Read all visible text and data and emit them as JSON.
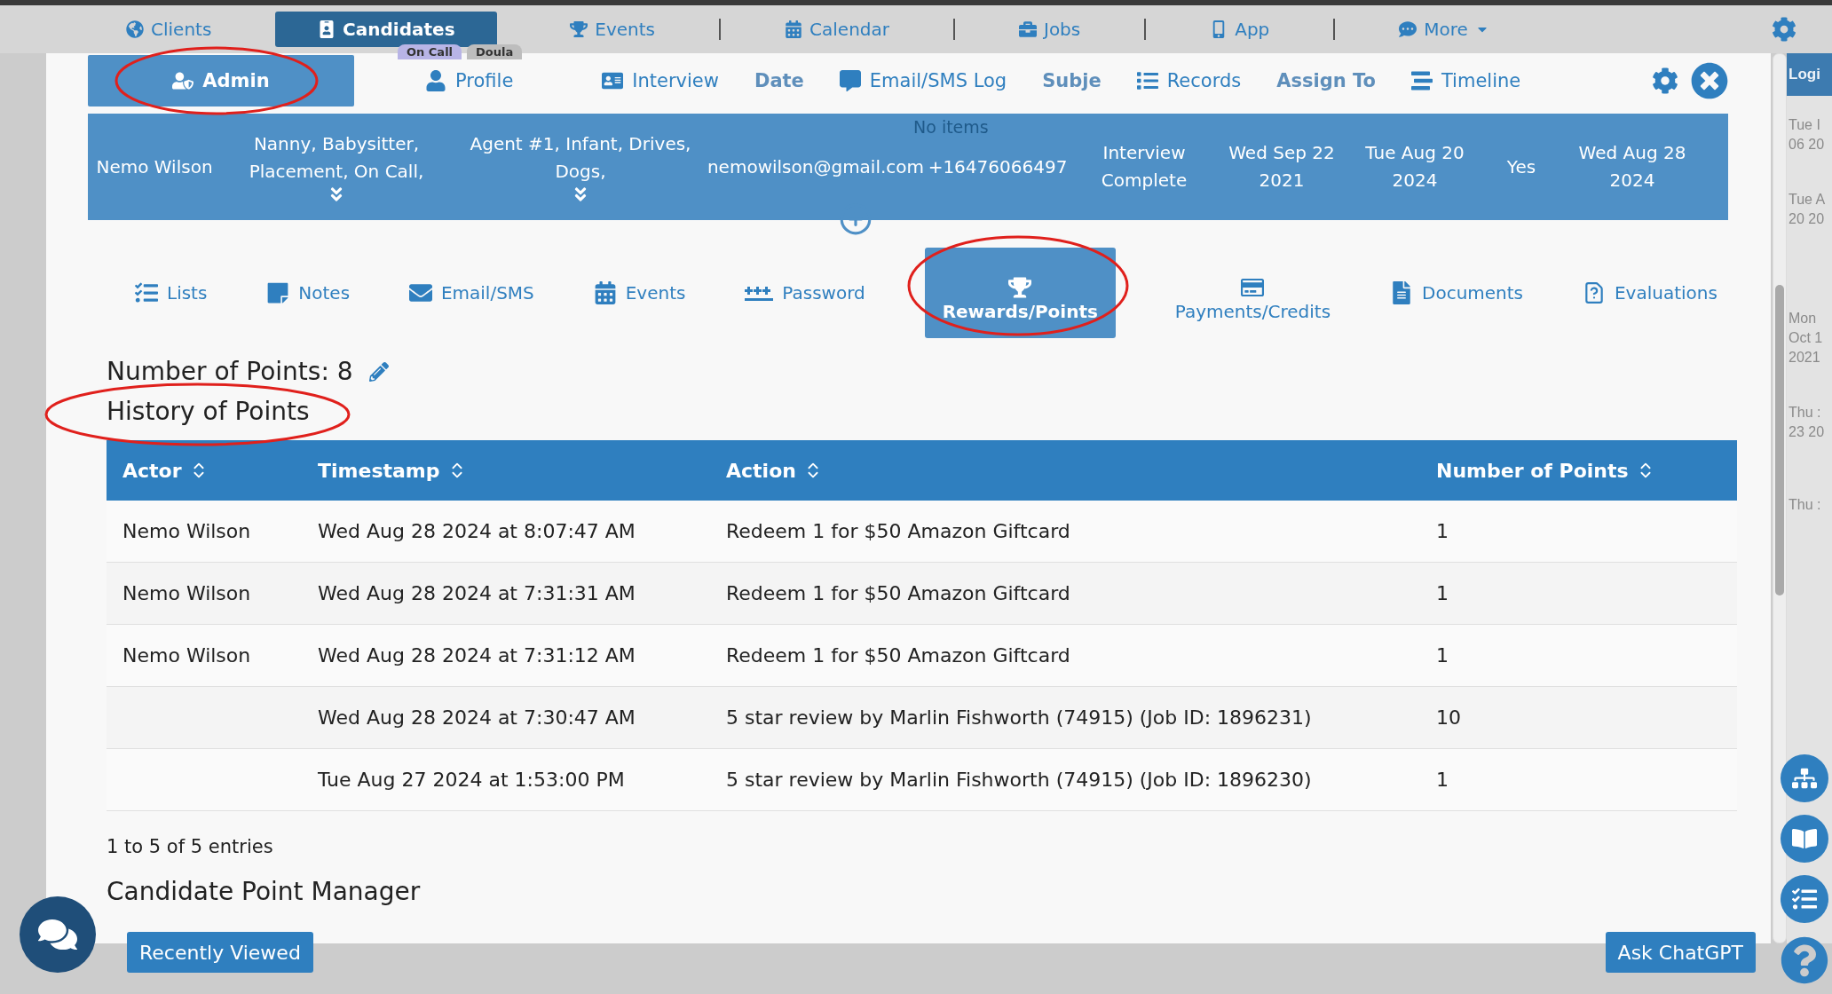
{
  "top_nav": {
    "items": [
      {
        "label": "Clients",
        "selected": false
      },
      {
        "label": "Candidates",
        "selected": true
      },
      {
        "label": "Events",
        "selected": false
      },
      {
        "label": "Calendar",
        "selected": false
      },
      {
        "label": "Jobs",
        "selected": false
      },
      {
        "label": "App",
        "selected": false
      },
      {
        "label": "More",
        "selected": false
      }
    ],
    "badges": [
      "On Call",
      "Doula"
    ]
  },
  "background_header": {
    "columns": [
      "Date",
      "Subje",
      "Assign To"
    ],
    "empty_text": "No items"
  },
  "background_list": {
    "title": "Logi",
    "lines": [
      "Tue I",
      "06 20",
      "Tue A",
      "20 20",
      "Mon",
      "Oct 1",
      "2021",
      "Thu :",
      "23 20",
      "Thu :"
    ]
  },
  "modal": {
    "tabs": [
      {
        "label": "Admin",
        "selected": true,
        "circled": true
      },
      {
        "label": "Profile",
        "selected": false,
        "circled": false
      },
      {
        "label": "Interview",
        "selected": false,
        "circled": false
      },
      {
        "label": "Email/SMS Log",
        "selected": false,
        "circled": false
      },
      {
        "label": "Records",
        "selected": false,
        "circled": false
      },
      {
        "label": "Timeline",
        "selected": false,
        "circled": false
      }
    ],
    "summary": [
      {
        "text": "Nemo Wilson",
        "expandable": false
      },
      {
        "text": "Nanny, Babysitter, Placement, On Call,",
        "expandable": true
      },
      {
        "text": "Agent #1, Infant, Drives, Dogs,",
        "expandable": true
      },
      {
        "text": "nemowilson@gmail.com",
        "expandable": false
      },
      {
        "text": "+16476066497",
        "expandable": false
      },
      {
        "text": "Interview Complete",
        "expandable": false
      },
      {
        "text": "Wed Sep 22 2021",
        "expandable": false
      },
      {
        "text": "Tue Aug 20 2024",
        "expandable": false
      },
      {
        "text": "Yes",
        "expandable": false
      },
      {
        "text": "Wed Aug 28 2024",
        "expandable": false
      }
    ],
    "sections": [
      {
        "label": "Lists",
        "selected": false,
        "circled": false,
        "kind": "inline"
      },
      {
        "label": "Notes",
        "selected": false,
        "circled": false,
        "kind": "inline"
      },
      {
        "label": "Email/SMS",
        "selected": false,
        "circled": false,
        "kind": "inline"
      },
      {
        "label": "Events",
        "selected": false,
        "circled": false,
        "kind": "inline"
      },
      {
        "label": "Password",
        "selected": false,
        "circled": false,
        "kind": "inline"
      },
      {
        "label": "Rewards/Points",
        "selected": true,
        "circled": true,
        "kind": "stacked"
      },
      {
        "label": "Payments/Credits",
        "selected": false,
        "circled": false,
        "kind": "stacked"
      },
      {
        "label": "Documents",
        "selected": false,
        "circled": false,
        "kind": "inline"
      },
      {
        "label": "Evaluations",
        "selected": false,
        "circled": false,
        "kind": "inline"
      }
    ],
    "points_label": "Number of Points: 8",
    "history_title": {
      "text": "History of Points",
      "circled": true
    },
    "table": {
      "columns": [
        "Actor",
        "Timestamp",
        "Action",
        "Number of Points"
      ],
      "rows": [
        [
          "Nemo Wilson",
          "Wed Aug 28 2024 at 8:07:47 AM",
          "Redeem 1 for $50 Amazon Giftcard",
          "1"
        ],
        [
          "Nemo Wilson",
          "Wed Aug 28 2024 at 7:31:31 AM",
          "Redeem 1 for $50 Amazon Giftcard",
          "1"
        ],
        [
          "Nemo Wilson",
          "Wed Aug 28 2024 at 7:31:12 AM",
          "Redeem 1 for $50 Amazon Giftcard",
          "1"
        ],
        [
          "",
          "Wed Aug 28 2024 at 7:30:47 AM",
          "5 star review by Marlin Fishworth (74915) (Job ID: 1896231)",
          "10"
        ],
        [
          "",
          "Tue Aug 27 2024 at 1:53:00 PM",
          "5 star review by Marlin Fishworth (74915) (Job ID: 1896230)",
          "1"
        ]
      ]
    },
    "entries_info": "1 to 5 of 5 entries",
    "manager_title": "Candidate Point Manager"
  },
  "bottom": {
    "recent_button": "Recently Viewed",
    "chat_button": "Ask ChatGPT"
  }
}
